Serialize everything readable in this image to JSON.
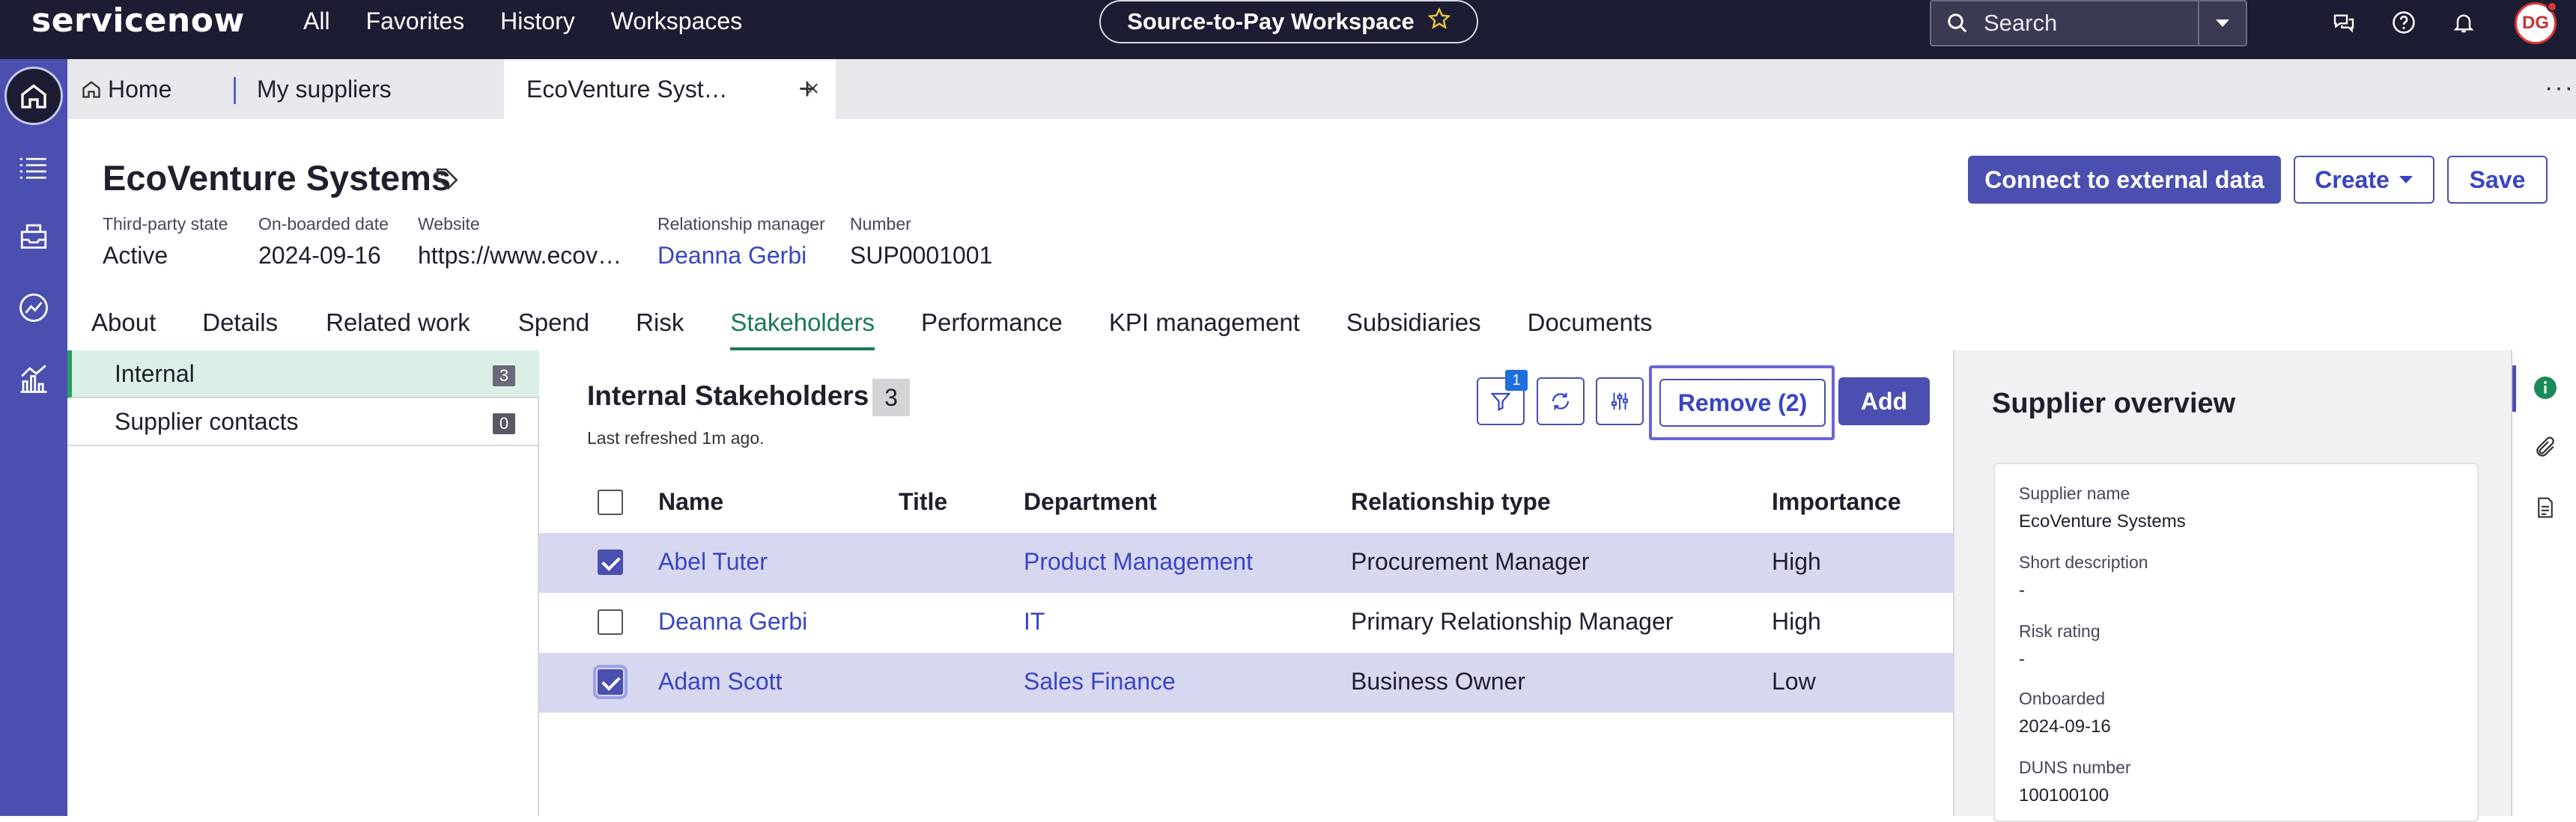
{
  "topbar": {
    "logo": "servicenow",
    "nav": [
      "All",
      "Favorites",
      "History",
      "Workspaces"
    ],
    "workspace": "Source-to-Pay Workspace",
    "search_placeholder": "Search",
    "avatar": "DG"
  },
  "tabs": {
    "home": "Home",
    "items": [
      {
        "label": "My suppliers",
        "close": "×"
      },
      {
        "label": "EcoVenture Syst…",
        "close": "×"
      }
    ],
    "add": "+",
    "more": "···"
  },
  "record": {
    "title": "EcoVenture Systems",
    "fields": [
      {
        "label": "Third-party state",
        "value": "Active"
      },
      {
        "label": "On-boarded date",
        "value": "2024-09-16"
      },
      {
        "label": "Website",
        "value": "https://www.ecov…"
      },
      {
        "label": "Relationship manager",
        "value": "Deanna Gerbi"
      },
      {
        "label": "Number",
        "value": "SUP0001001"
      }
    ],
    "actions": {
      "connect": "Connect to external data",
      "create": "Create",
      "save": "Save"
    }
  },
  "subtabs": [
    "About",
    "Details",
    "Related work",
    "Spend",
    "Risk",
    "Stakeholders",
    "Performance",
    "KPI management",
    "Subsidiaries",
    "Documents"
  ],
  "left_panel": [
    {
      "label": "Internal",
      "count": "3"
    },
    {
      "label": "Supplier contacts",
      "count": "0"
    }
  ],
  "stakeholders": {
    "title": "Internal Stakeholders",
    "count": "3",
    "refreshed": "Last refreshed 1m ago.",
    "filter_badge": "1",
    "remove": "Remove (2)",
    "add": "Add",
    "columns": [
      "Name",
      "Title",
      "Department",
      "Relationship type",
      "Importance"
    ],
    "rows": [
      {
        "name": "Abel Tuter",
        "title": "",
        "department": "Product Management",
        "relationship": "Procurement Manager",
        "importance": "High",
        "selected": true
      },
      {
        "name": "Deanna Gerbi",
        "title": "",
        "department": "IT",
        "relationship": "Primary Relationship Manager",
        "importance": "High",
        "selected": false
      },
      {
        "name": "Adam Scott",
        "title": "",
        "department": "Sales Finance",
        "relationship": "Business Owner",
        "importance": "Low",
        "selected": true
      }
    ]
  },
  "overview": {
    "title": "Supplier overview",
    "fields": [
      {
        "label": "Supplier name",
        "value": "EcoVenture Systems"
      },
      {
        "label": "Short description",
        "value": "-"
      },
      {
        "label": "Risk rating",
        "value": "-"
      },
      {
        "label": "Onboarded",
        "value": "2024-09-16"
      },
      {
        "label": "DUNS number",
        "value": "100100100"
      }
    ]
  },
  "colors": {
    "topbar": "#1c1d33",
    "rail": "#4b4fb0",
    "accent": "#4b4fb0",
    "active_tab": "#1a7a55",
    "link": "#3a45c2"
  }
}
